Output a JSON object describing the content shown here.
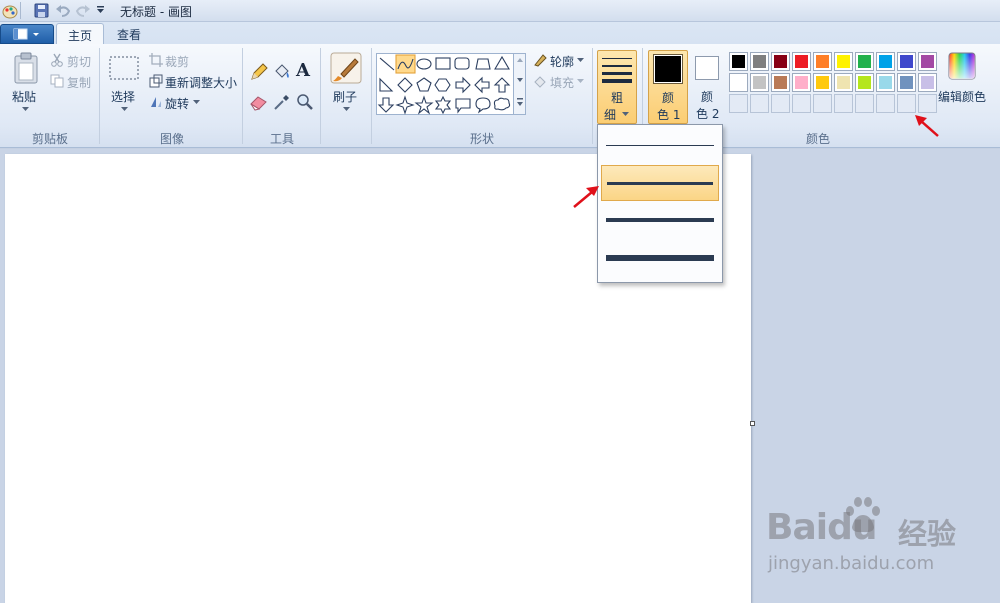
{
  "window": {
    "title": "无标题 - 画图"
  },
  "tabs": [
    {
      "label": "主页",
      "active": true
    },
    {
      "label": "查看",
      "active": false
    }
  ],
  "clipboard": {
    "paste_label": "粘贴",
    "cut_label": "剪切",
    "copy_label": "复制",
    "group_label": "剪贴板"
  },
  "image": {
    "select_label": "选择",
    "crop_label": "裁剪",
    "resize_label": "重新调整大小",
    "rotate_label": "旋转",
    "group_label": "图像"
  },
  "tools": {
    "group_label": "工具",
    "text_tool_glyph": "A"
  },
  "brushes": {
    "label": "刷子"
  },
  "shapes": {
    "outline_label": "轮廓",
    "fill_label": "填充",
    "group_label": "形状"
  },
  "size": {
    "label_line1": "粗",
    "label_line2": "细",
    "options_count": 4,
    "selected_option": 2
  },
  "colors": {
    "color1_line1": "颜",
    "color1_line2": "色 1",
    "color2_line1": "颜",
    "color2_line2": "色 2",
    "edit_colors_label": "编辑颜色",
    "group_label": "颜色",
    "color1_value": "#000000",
    "color2_value": "#ffffff",
    "palette_row1": [
      "#000000",
      "#7f7f7f",
      "#880015",
      "#ed1c24",
      "#ff7f27",
      "#fff200",
      "#22b14c",
      "#00a2e8",
      "#3f48cc",
      "#a349a4"
    ],
    "palette_row2": [
      "#ffffff",
      "#c3c3c3",
      "#b97a57",
      "#ffaec9",
      "#ffc90e",
      "#efe4b0",
      "#b5e61d",
      "#99d9ea",
      "#7092be",
      "#c8bfe7"
    ],
    "custom_slots": 10
  },
  "watermark": {
    "brand": "Baidu",
    "brand_cn": "经验",
    "url": "jingyan.baidu.com"
  },
  "accent": {
    "selection": "#fbd586",
    "arrow": "#e0101a"
  }
}
